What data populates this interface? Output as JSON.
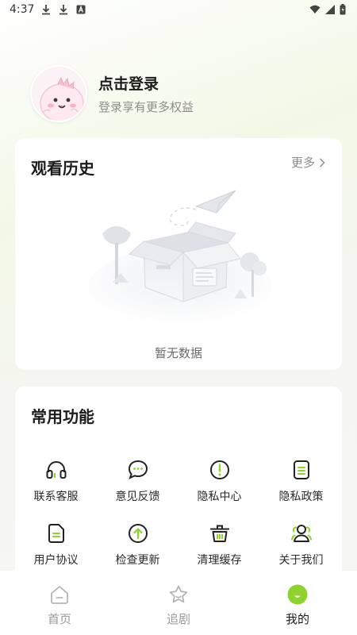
{
  "status_bar": {
    "time": "4:37"
  },
  "profile": {
    "title": "点击登录",
    "subtitle": "登录享有更多权益"
  },
  "history": {
    "title": "观看历史",
    "more": "更多",
    "empty_text": "暂无数据"
  },
  "functions": {
    "title": "常用功能",
    "items": [
      {
        "label": "联系客服",
        "icon": "headset-icon"
      },
      {
        "label": "意见反馈",
        "icon": "chat-bubble-icon"
      },
      {
        "label": "隐私中心",
        "icon": "exclamation-circle-icon"
      },
      {
        "label": "隐私政策",
        "icon": "document-list-icon"
      },
      {
        "label": "用户协议",
        "icon": "file-icon"
      },
      {
        "label": "检查更新",
        "icon": "arrow-up-circle-icon"
      },
      {
        "label": "清理缓存",
        "icon": "basket-icon"
      },
      {
        "label": "关于我们",
        "icon": "team-icon"
      }
    ]
  },
  "tabbar": {
    "tabs": [
      {
        "label": "首页",
        "icon": "home-icon",
        "active": false
      },
      {
        "label": "追剧",
        "icon": "star-icon",
        "active": false
      },
      {
        "label": "我的",
        "icon": "profile-face-icon",
        "active": true
      }
    ]
  },
  "colors": {
    "accent": "#8fd12d",
    "icon_stroke": "#222222",
    "muted": "#8d8d8d"
  }
}
